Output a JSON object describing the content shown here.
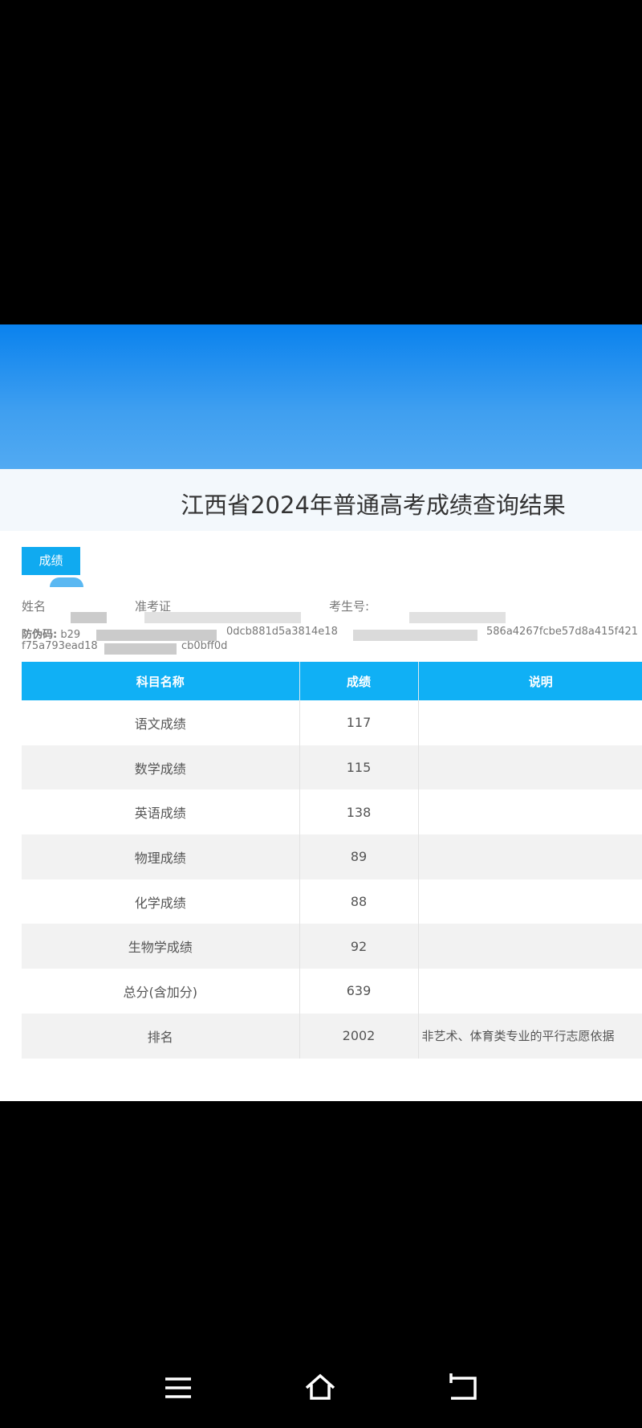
{
  "page": {
    "title": "江西省2024年普通高考成绩查询结果",
    "tab_label": "成绩"
  },
  "info": {
    "name_label": "姓名",
    "ticket_label": "准考证",
    "exam_no_label": "考生号:",
    "anti_fake_label": "防伪码:",
    "code_frag1": "b29",
    "code_frag2": "0dcb881d5a3814e18",
    "code_frag3": "586a4267fcbe57d8a415f421",
    "code_frag4": "f75a793ead18",
    "code_frag5": "cb0bff0d"
  },
  "table": {
    "headers": [
      "科目名称",
      "成绩",
      "说明"
    ],
    "rows": [
      {
        "subject": "语文成绩",
        "score": "117",
        "note": ""
      },
      {
        "subject": "数学成绩",
        "score": "115",
        "note": ""
      },
      {
        "subject": "英语成绩",
        "score": "138",
        "note": ""
      },
      {
        "subject": "物理成绩",
        "score": "89",
        "note": ""
      },
      {
        "subject": "化学成绩",
        "score": "88",
        "note": ""
      },
      {
        "subject": "生物学成绩",
        "score": "92",
        "note": ""
      },
      {
        "subject": "总分(含加分)",
        "score": "639",
        "note": ""
      },
      {
        "subject": "排名",
        "score": "2002",
        "note": "非艺术、体育类专业的平行志愿依据"
      }
    ]
  },
  "colors": {
    "header_blue": "#0a82ee",
    "table_header": "#10b0f5"
  },
  "navbar": {
    "icons": [
      "menu-icon",
      "home-icon",
      "back-icon"
    ]
  }
}
